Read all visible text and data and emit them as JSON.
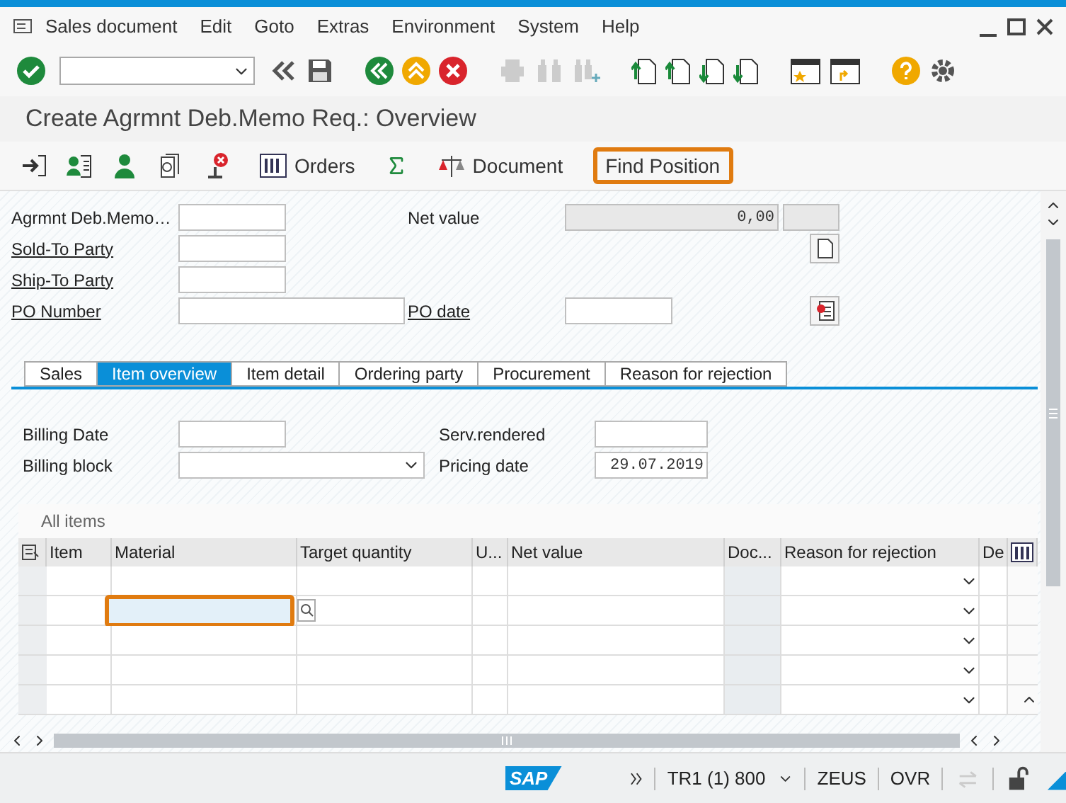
{
  "menu": [
    "Sales document",
    "Edit",
    "Goto",
    "Extras",
    "Environment",
    "System",
    "Help"
  ],
  "title": "Create Agrmnt Deb.Memo Req.: Overview",
  "app_toolbar": [
    {
      "label": "Orders",
      "highlighted": false
    },
    {
      "label": "Document",
      "highlighted": false
    },
    {
      "label": "Find Position",
      "highlighted": true
    }
  ],
  "header_fields": [
    {
      "label": "Agrmnt Deb.Memo…",
      "link": false
    },
    {
      "label": "Sold-To Party",
      "link": true
    },
    {
      "label": "Ship-To Party",
      "link": true
    },
    {
      "label": "PO Number",
      "link": true
    }
  ],
  "net_value": {
    "label": "Net value",
    "value": "0,00"
  },
  "po_date": {
    "label": "PO date"
  },
  "tabs": [
    {
      "label": "Sales",
      "selected": false
    },
    {
      "label": "Item overview",
      "selected": true
    },
    {
      "label": "Item detail",
      "selected": false
    },
    {
      "label": "Ordering party",
      "selected": false
    },
    {
      "label": "Procurement",
      "selected": false
    },
    {
      "label": "Reason for rejection",
      "selected": false
    }
  ],
  "billing_fields": [
    {
      "label": "Billing Date"
    },
    {
      "label": "Billing block"
    }
  ],
  "service_fields": [
    {
      "label": "Serv.rendered"
    },
    {
      "label": "Pricing date",
      "value": "29.07.2019"
    }
  ],
  "table": {
    "title": "All items",
    "columns": [
      "Item",
      "Material",
      "Target quantity",
      "U...",
      "Net value",
      "Doc...",
      "Reason for rejection",
      "De"
    ],
    "rows": [
      {
        "focused": false
      },
      {
        "focused": true
      },
      {
        "focused": false
      },
      {
        "focused": false
      },
      {
        "focused": false
      }
    ]
  },
  "status_bar": {
    "logo": "SAP",
    "system": "TR1 (1) 800",
    "host": "ZEUS",
    "mode": "OVR"
  }
}
